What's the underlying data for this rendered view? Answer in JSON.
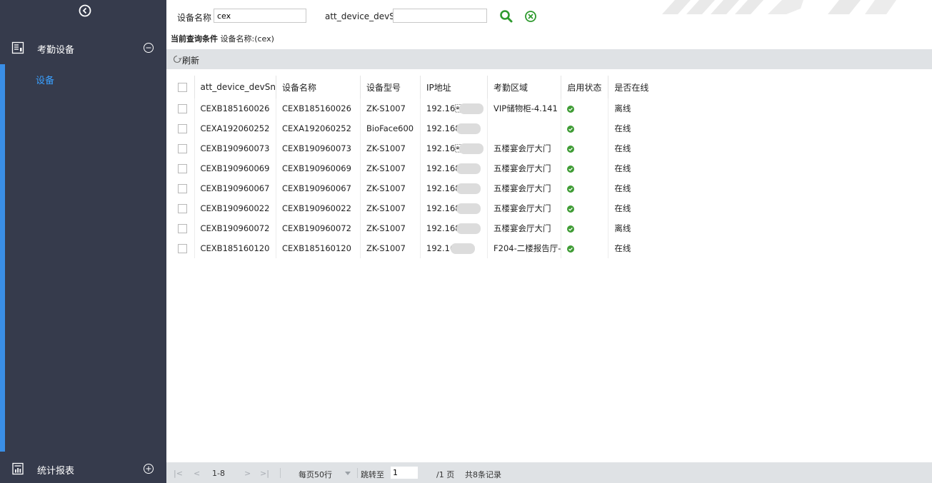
{
  "sidebar": {
    "collapse_icon": "chevron-left-circle-icon",
    "groups": [
      {
        "label": "考勤设备",
        "icon": "device-panel-icon",
        "toggle": "minus-circle-icon"
      },
      {
        "label": "统计报表",
        "icon": "report-icon",
        "toggle": "plus-circle-icon"
      }
    ],
    "active_item": "设备",
    "accent_color": "#3a8ee6",
    "background": "#363b4c"
  },
  "search": {
    "name_label": "设备名称",
    "name_value": "cex",
    "sn_label": "att_device_devSn",
    "sn_value": "",
    "search_icon": "search-icon",
    "clear_icon": "clear-circle-icon"
  },
  "query_condition": {
    "title": "当前查询条件",
    "text": "设备名称:(cex)"
  },
  "toolbar": {
    "refresh_label": "刷新",
    "refresh_icon": "refresh-icon"
  },
  "table": {
    "headers": [
      "att_device_devSn",
      "设备名称",
      "设备型号",
      "IP地址",
      "考勤区域",
      "启用状态",
      "是否在线"
    ],
    "rows": [
      {
        "sn": "CEXB185160026",
        "name": "CEXB185160026",
        "model": "ZK-S1007",
        "ip": "192.16\b",
        "area": "VIP储物柜-4.141",
        "enabled": true,
        "online": "离线",
        "online_state": "offline"
      },
      {
        "sn": "CEXA192060252",
        "name": "CEXA192060252",
        "model": "BioFace600",
        "ip": "192.168",
        "area": "",
        "enabled": true,
        "online": "在线",
        "online_state": "online"
      },
      {
        "sn": "CEXB190960073",
        "name": "CEXB190960073",
        "model": "ZK-S1007",
        "ip": "192.16\b",
        "area": "五楼宴会厅大门",
        "enabled": true,
        "online": "在线",
        "online_state": "online"
      },
      {
        "sn": "CEXB190960069",
        "name": "CEXB190960069",
        "model": "ZK-S1007",
        "ip": "192.168",
        "area": "五楼宴会厅大门",
        "enabled": true,
        "online": "在线",
        "online_state": "online"
      },
      {
        "sn": "CEXB190960067",
        "name": "CEXB190960067",
        "model": "ZK-S1007",
        "ip": "192.168",
        "area": "五楼宴会厅大门",
        "enabled": true,
        "online": "在线",
        "online_state": "online"
      },
      {
        "sn": "CEXB190960022",
        "name": "CEXB190960022",
        "model": "ZK-S1007",
        "ip": "192.168",
        "area": "五楼宴会厅大门",
        "enabled": true,
        "online": "在线",
        "online_state": "online"
      },
      {
        "sn": "CEXB190960072",
        "name": "CEXB190960072",
        "model": "ZK-S1007",
        "ip": "192.168",
        "area": "五楼宴会厅大门",
        "enabled": true,
        "online": "离线",
        "online_state": "offline"
      },
      {
        "sn": "CEXB185160120",
        "name": "CEXB185160120",
        "model": "ZK-S1007",
        "ip": "192.16",
        "area": "F204-二楼报告厅-",
        "enabled": true,
        "online": "在线",
        "online_state": "online"
      }
    ],
    "enabled_icon": "check-circle-icon",
    "online_color": "#1f8a1f",
    "offline_color": "#e60000"
  },
  "pager": {
    "first": "|<",
    "prev": "<",
    "range": "1-8",
    "next": ">",
    "last": ">|",
    "per_page": "每页50行",
    "per_page_icon": "dropdown-arrow-icon",
    "jump_label": "跳转至",
    "jump_value": "1",
    "pages": "/1 页",
    "total": "共8条记录"
  }
}
